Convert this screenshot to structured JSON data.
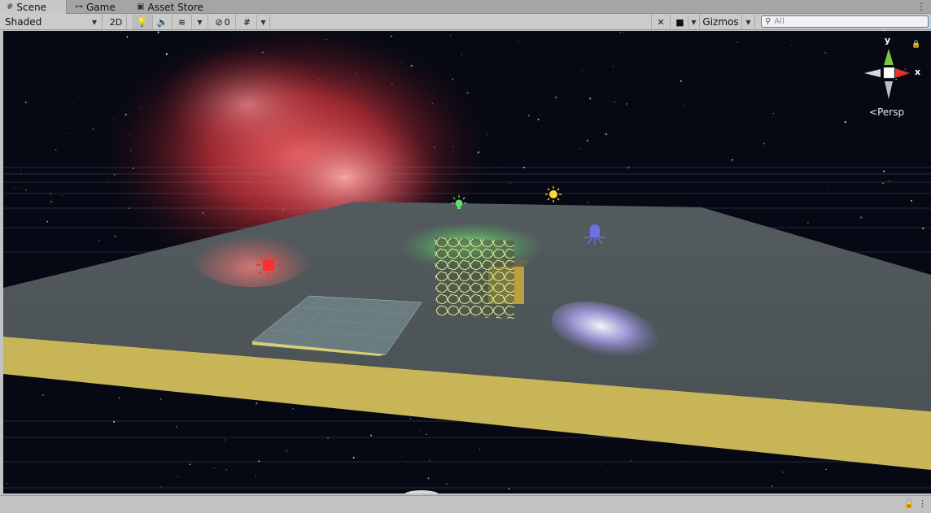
{
  "tabs": [
    {
      "label": "Scene",
      "icon": "grid-icon",
      "active": true
    },
    {
      "label": "Game",
      "icon": "gamepad-icon",
      "active": false
    },
    {
      "label": "Asset Store",
      "icon": "bag-icon",
      "active": false
    }
  ],
  "toolbar": {
    "shading_mode": "Shaded",
    "mode_2d": "2D",
    "hidden_count": "0",
    "gizmos_label": "Gizmos",
    "search_placeholder": "All"
  },
  "gizmo": {
    "y_label": "y",
    "x_label": "x",
    "projection": "Persp"
  },
  "colors": {
    "toolbar_bg": "#cbcbcb",
    "tab_bg": "#a5a5a5",
    "search_border": "#4a7fd0",
    "platform_top": "#4d5559",
    "platform_side": "#c9b656",
    "nebula": "#d8373d",
    "green_light": "#5fe06a",
    "spot_light": "#c9c2ff"
  }
}
